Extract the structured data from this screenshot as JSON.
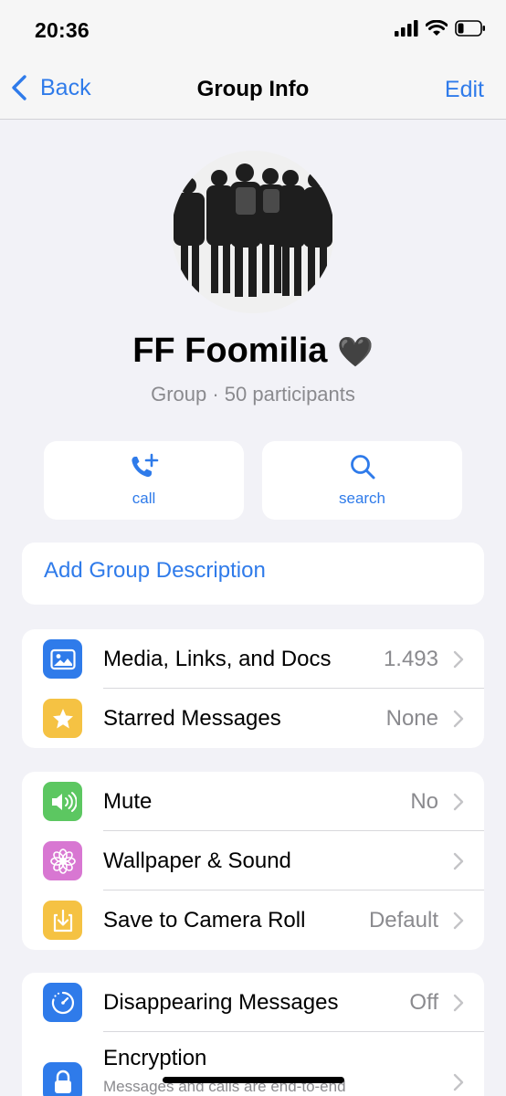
{
  "status_bar": {
    "time": "20:36"
  },
  "nav": {
    "back_label": "Back",
    "title": "Group Info",
    "edit_label": "Edit"
  },
  "group": {
    "name": "FF Foomilia",
    "emoji": "🖤",
    "subtitle": "Group · 50 participants"
  },
  "actions": [
    {
      "label": "call",
      "icon": "phone-plus-icon"
    },
    {
      "label": "search",
      "icon": "magnifier-icon"
    }
  ],
  "description_link": "Add Group Description",
  "section1": [
    {
      "label": "Media, Links, and Docs",
      "value": "1.493",
      "icon": "photo-icon",
      "color": "#2f7bea"
    },
    {
      "label": "Starred Messages",
      "value": "None",
      "icon": "star-icon",
      "color": "#f5c243"
    }
  ],
  "section2": [
    {
      "label": "Mute",
      "value": "No",
      "icon": "speaker-icon",
      "color": "#5cc761"
    },
    {
      "label": "Wallpaper & Sound",
      "value": "",
      "icon": "flower-icon",
      "color": "#d877d2"
    },
    {
      "label": "Save to Camera Roll",
      "value": "Default",
      "icon": "download-icon",
      "color": "#f5c243"
    }
  ],
  "section3": [
    {
      "label": "Disappearing Messages",
      "value": "Off",
      "icon": "timer-icon",
      "color": "#2f7bea"
    },
    {
      "label": "Encryption",
      "sublabel": "Messages and calls are end-to-end",
      "icon": "lock-icon",
      "color": "#2f7bea"
    }
  ],
  "colors": {
    "accent": "#2f7bea",
    "background": "#f2f2f7"
  }
}
